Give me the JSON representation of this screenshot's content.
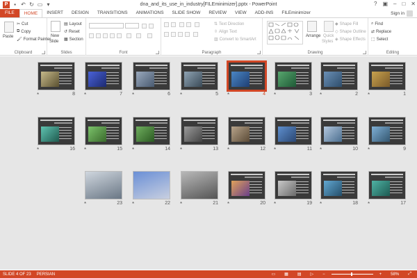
{
  "window": {
    "title": "dna_and_its_use_in_industry[FILEminimizer].pptx - PowerPoint"
  },
  "tabs": [
    "FILE",
    "HOME",
    "INSERT",
    "DESIGN",
    "TRANSITIONS",
    "ANIMATIONS",
    "SLIDE SHOW",
    "REVIEW",
    "VIEW",
    "ADD-INS",
    "FILEminimizer"
  ],
  "account": {
    "signin": "Sign in"
  },
  "ribbon": {
    "clipboard": {
      "paste": "Paste",
      "cut": "Cut",
      "copy": "Copy",
      "format_painter": "Format Painter",
      "label": "Clipboard"
    },
    "slides": {
      "new_slide": "New",
      "new_slide2": "Slide",
      "layout": "Layout",
      "reset": "Reset",
      "section": "Section",
      "label": "Slides"
    },
    "font": {
      "label": "Font"
    },
    "paragraph": {
      "text_direction": "Text Direction",
      "align_text": "Align Text",
      "convert": "Convert to SmartArt",
      "label": "Paragraph"
    },
    "drawing": {
      "arrange": "Arrange",
      "quick_styles": "Quick",
      "quick_styles2": "Styles",
      "shape_fill": "Shape Fill",
      "shape_outline": "Shape Outline",
      "shape_effects": "Shape Effects",
      "label": "Drawing"
    },
    "editing": {
      "find": "Find",
      "replace": "Replace",
      "select": "Select",
      "label": "Editing"
    }
  },
  "slides": [
    {
      "num": "1",
      "selected": false
    },
    {
      "num": "2",
      "selected": false
    },
    {
      "num": "3",
      "selected": false
    },
    {
      "num": "4",
      "selected": true
    },
    {
      "num": "5",
      "selected": false
    },
    {
      "num": "6",
      "selected": false
    },
    {
      "num": "7",
      "selected": false
    },
    {
      "num": "8",
      "selected": false
    },
    {
      "num": "9",
      "selected": false
    },
    {
      "num": "10",
      "selected": false
    },
    {
      "num": "11",
      "selected": false
    },
    {
      "num": "12",
      "selected": false
    },
    {
      "num": "13",
      "selected": false
    },
    {
      "num": "14",
      "selected": false
    },
    {
      "num": "15",
      "selected": false
    },
    {
      "num": "16",
      "selected": false
    },
    {
      "num": "17",
      "selected": false
    },
    {
      "num": "18",
      "selected": false
    },
    {
      "num": "19",
      "selected": false
    },
    {
      "num": "20",
      "selected": false
    },
    {
      "num": "21",
      "selected": false
    },
    {
      "num": "22",
      "selected": false
    },
    {
      "num": "23",
      "selected": false
    }
  ],
  "status": {
    "slide": "SLIDE 4 OF 23",
    "language": "PERSIAN",
    "zoom": "58%"
  }
}
